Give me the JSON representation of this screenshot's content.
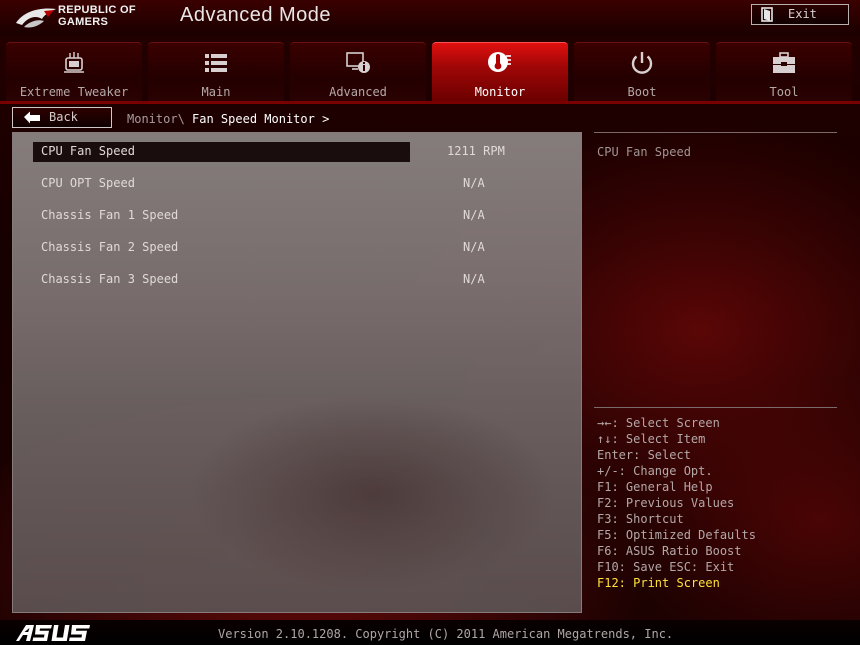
{
  "header": {
    "brand_line1": "REPUBLIC OF",
    "brand_line2": "GAMERS",
    "mode_title": "Advanced Mode",
    "exit_label": "Exit"
  },
  "tabs": [
    {
      "label": "Extreme Tweaker",
      "icon": "extreme-tweaker-icon",
      "active": false
    },
    {
      "label": "Main",
      "icon": "list-icon",
      "active": false
    },
    {
      "label": "Advanced",
      "icon": "advanced-settings-icon",
      "active": false
    },
    {
      "label": "Monitor",
      "icon": "monitor-thermometer-icon",
      "active": true
    },
    {
      "label": "Boot",
      "icon": "power-icon",
      "active": false
    },
    {
      "label": "Tool",
      "icon": "toolbox-icon",
      "active": false
    }
  ],
  "nav": {
    "back_label": "Back",
    "breadcrumb_parent": "Monitor\\",
    "breadcrumb_current": "Fan Speed Monitor >"
  },
  "items": [
    {
      "label": "CPU Fan Speed",
      "value": "1211 RPM",
      "selected": true
    },
    {
      "label": "CPU OPT Speed",
      "value": "N/A",
      "selected": false
    },
    {
      "label": "Chassis Fan 1 Speed",
      "value": "N/A",
      "selected": false
    },
    {
      "label": "Chassis Fan 2 Speed",
      "value": "N/A",
      "selected": false
    },
    {
      "label": "Chassis Fan 3 Speed",
      "value": "N/A",
      "selected": false
    }
  ],
  "help": {
    "title": "CPU Fan Speed",
    "keys": [
      "→←: Select Screen",
      "↑↓: Select Item",
      "Enter: Select",
      "+/-: Change Opt.",
      "F1: General Help",
      "F2: Previous Values",
      "F3: Shortcut",
      "F5: Optimized Defaults",
      "F6: ASUS Ratio Boost",
      "F10: Save  ESC: Exit",
      "F12: Print Screen"
    ]
  },
  "footer": {
    "version": "Version 2.10.1208. Copyright (C) 2011 American Megatrends, Inc.",
    "logo": "ASUS"
  },
  "colors": {
    "accent_red": "#d00a0a",
    "highlight_yellow": "#ffe23a",
    "panel_gray": "#7e7373"
  }
}
